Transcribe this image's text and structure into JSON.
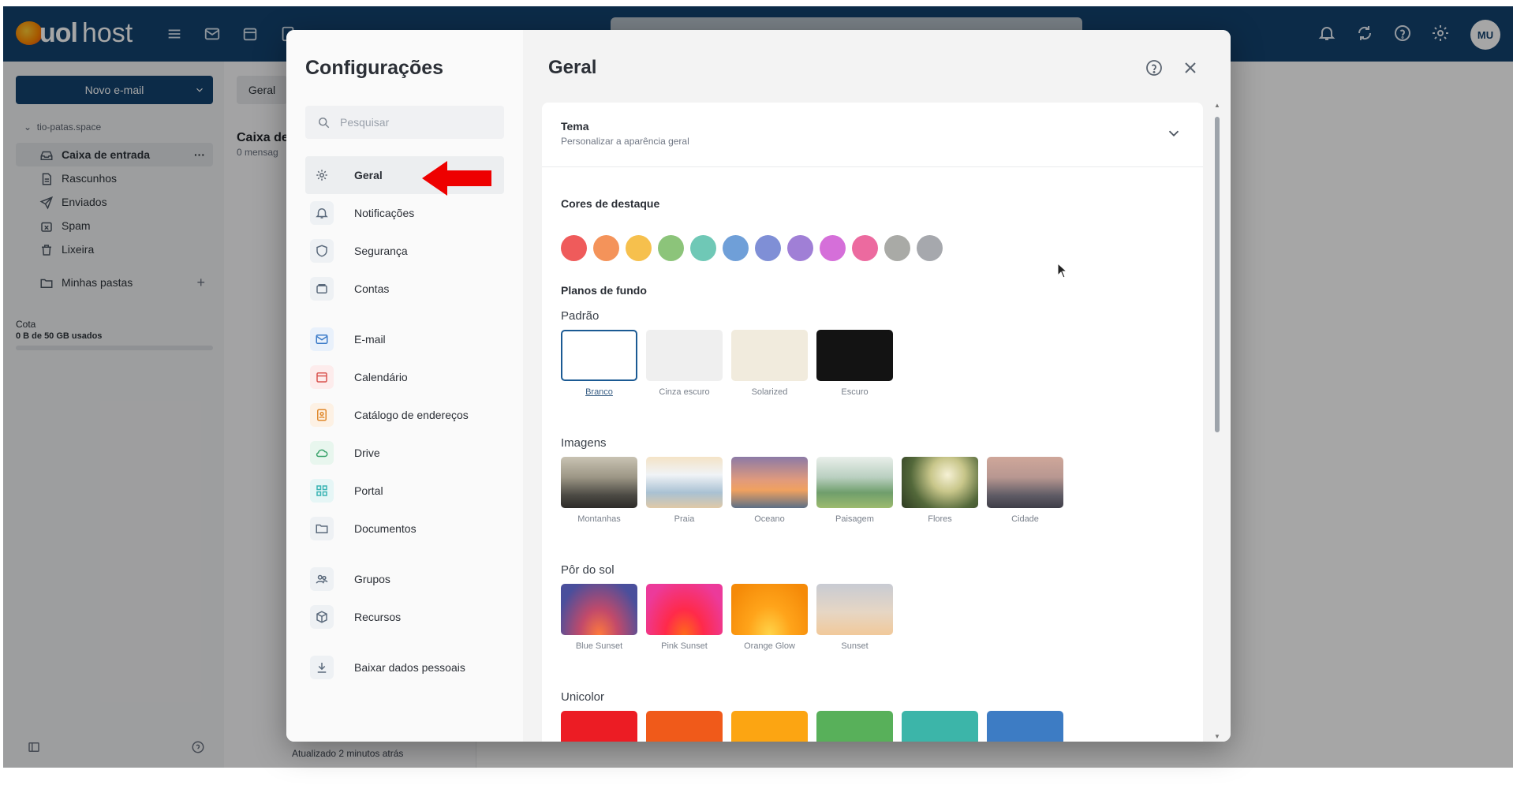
{
  "topbar": {
    "logo_uol": "uol",
    "logo_host": "host",
    "avatar_initials": "MU",
    "icons": [
      "menu-icon",
      "mail-icon",
      "calendar-icon",
      "contacts-icon",
      "bell-icon",
      "sync-icon",
      "help-icon",
      "gear-icon"
    ]
  },
  "app": {
    "new_mail_label": "Novo e-mail",
    "account": "tio-patas.space",
    "folders": [
      {
        "label": "Caixa de entrada",
        "icon": "inbox-icon",
        "selected": true
      },
      {
        "label": "Rascunhos",
        "icon": "draft-icon"
      },
      {
        "label": "Enviados",
        "icon": "send-icon"
      },
      {
        "label": "Spam",
        "icon": "spam-icon"
      },
      {
        "label": "Lixeira",
        "icon": "trash-icon"
      }
    ],
    "my_folders": "Minhas pastas",
    "quota_label": "Cota",
    "quota_value": "0 B de 50 GB usados",
    "chip_geral": "Geral",
    "inbox_title": "Caixa de",
    "inbox_sub": "0 mensag",
    "updated": "Atualizado 2 minutos atrás"
  },
  "settings": {
    "title": "Configurações",
    "search_placeholder": "Pesquisar",
    "nav": [
      {
        "label": "Geral",
        "icon": "gear-icon",
        "active": true
      },
      {
        "label": "Notificações",
        "icon": "bell-icon"
      },
      {
        "label": "Segurança",
        "icon": "shield-icon"
      },
      {
        "label": "Contas",
        "icon": "account-icon"
      },
      {
        "label": "E-mail",
        "icon": "mail-icon"
      },
      {
        "label": "Calendário",
        "icon": "calendar-icon"
      },
      {
        "label": "Catálogo de endereços",
        "icon": "contacts-icon"
      },
      {
        "label": "Drive",
        "icon": "cloud-icon"
      },
      {
        "label": "Portal",
        "icon": "grid-icon"
      },
      {
        "label": "Documentos",
        "icon": "folder-icon"
      },
      {
        "label": "Grupos",
        "icon": "group-icon"
      },
      {
        "label": "Recursos",
        "icon": "cube-icon"
      },
      {
        "label": "Baixar dados pessoais",
        "icon": "download-icon"
      }
    ],
    "content_title": "Geral",
    "tema_title": "Tema",
    "tema_sub": "Personalizar a aparência geral",
    "accent_title": "Cores de destaque",
    "accent_colors": [
      "#ef5b5b",
      "#f4935a",
      "#f6c04d",
      "#8cc47a",
      "#6fc8b6",
      "#6f9fd8",
      "#7f8fd6",
      "#a07fd6",
      "#d56fd9",
      "#ec6a9f",
      "#a9aaa6",
      "#a6a8ad"
    ],
    "backgrounds_title": "Planos de fundo",
    "groups": {
      "padrao": {
        "title": "Padrão",
        "items": [
          {
            "label": "Branco",
            "selected": true
          },
          {
            "label": "Cinza escuro"
          },
          {
            "label": "Solarized"
          },
          {
            "label": "Escuro"
          }
        ]
      },
      "imagens": {
        "title": "Imagens",
        "items": [
          {
            "label": "Montanhas"
          },
          {
            "label": "Praia"
          },
          {
            "label": "Oceano"
          },
          {
            "label": "Paisagem"
          },
          {
            "label": "Flores"
          },
          {
            "label": "Cidade"
          }
        ]
      },
      "por_do_sol": {
        "title": "Pôr do sol",
        "items": [
          {
            "label": "Blue Sunset"
          },
          {
            "label": "Pink Sunset"
          },
          {
            "label": "Orange Glow"
          },
          {
            "label": "Sunset"
          }
        ]
      },
      "unicolor": {
        "title": "Unicolor",
        "colors": [
          "#ec1c24",
          "#f05a1a",
          "#fca512",
          "#58b05a",
          "#3cb5a9",
          "#3d7cc4"
        ]
      }
    }
  }
}
